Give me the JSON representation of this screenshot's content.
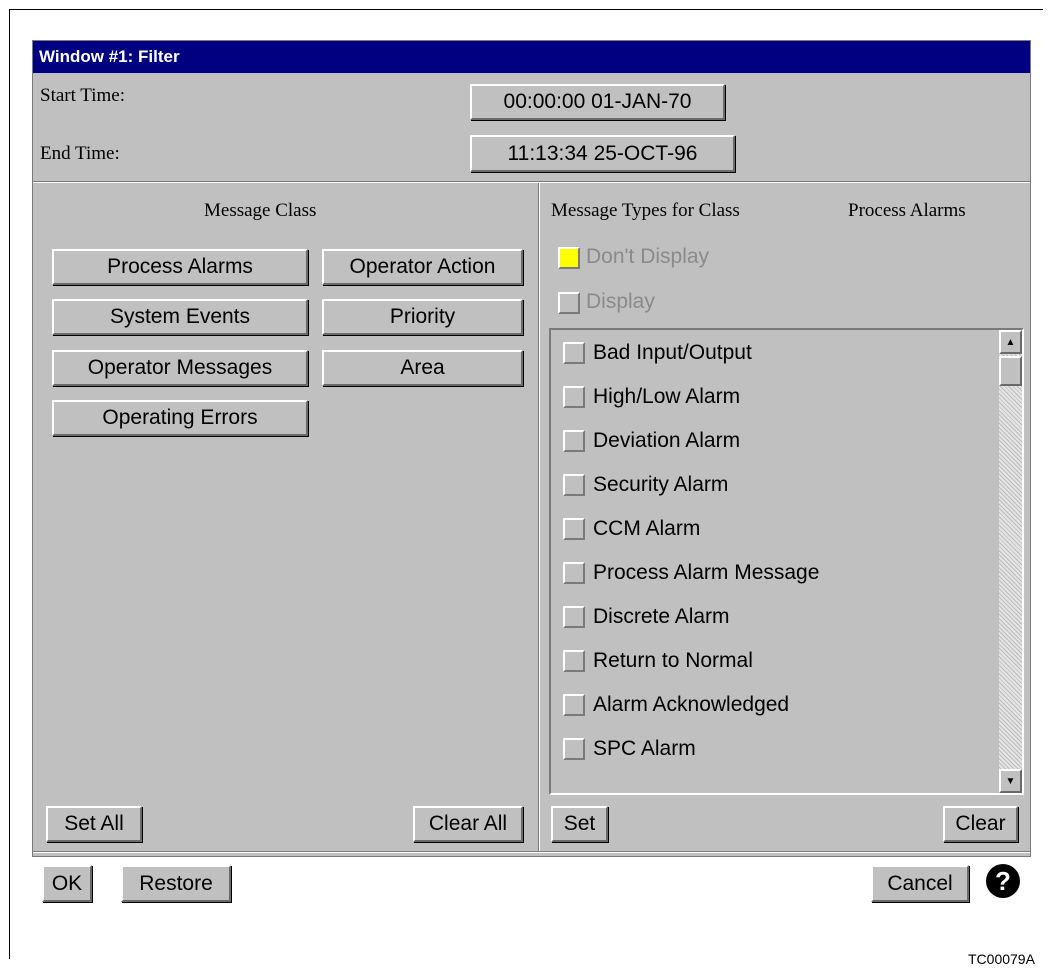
{
  "window": {
    "title": "Window #1: Filter"
  },
  "time": {
    "start_label": "Start Time:",
    "start_value": "00:00:00  01-JAN-70",
    "end_label": "End Time:",
    "end_value": "11:13:34  25-OCT-96"
  },
  "message_class": {
    "heading": "Message Class",
    "buttons": [
      "Process Alarms",
      "Operator Action",
      "System Events",
      "Priority",
      "Operator Messages",
      "Area",
      "Operating Errors"
    ],
    "set_all": "Set All",
    "clear_all": "Clear All"
  },
  "message_types": {
    "heading": "Message Types for Class",
    "selected_class": "Process Alarms",
    "dont_display": "Don't Display",
    "display": "Display",
    "items": [
      "Bad Input/Output",
      "High/Low Alarm",
      "Deviation Alarm",
      "Security Alarm",
      "CCM Alarm",
      "Process Alarm Message",
      "Discrete Alarm",
      "Return to Normal",
      "Alarm Acknowledged",
      "SPC Alarm"
    ],
    "set": "Set",
    "clear": "Clear"
  },
  "footer": {
    "ok": "OK",
    "restore": "Restore",
    "cancel": "Cancel",
    "help_glyph": "?"
  },
  "caption": "TC00079A",
  "colors": {
    "title_bar": "#000080",
    "panel": "#c0c0c0",
    "dont_display_indicator": "#ffff00"
  }
}
